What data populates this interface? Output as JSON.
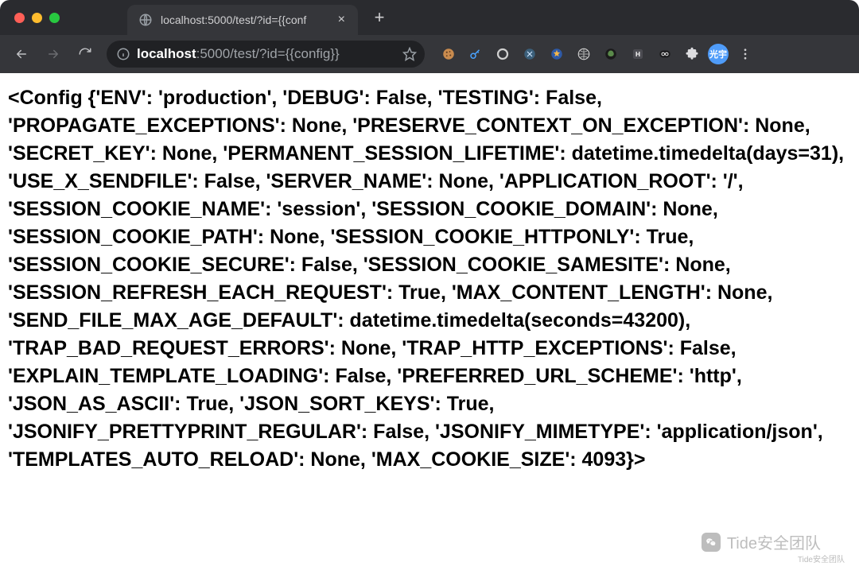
{
  "browser": {
    "tab_title": "localhost:5000/test/?id={{conf",
    "new_tab_label": "+",
    "close_tab_label": "×",
    "url_host": "localhost",
    "url_port_path": ":5000/test/?id={{config}}",
    "avatar_label": "光宇"
  },
  "icons": {
    "back": "back-icon",
    "forward": "forward-icon",
    "reload": "reload-icon",
    "info": "info-icon",
    "star": "star-outline-icon",
    "extensions": "puzzle-icon",
    "menu": "kebab-icon"
  },
  "page": {
    "body_text": "<Config {'ENV': 'production', 'DEBUG': False, 'TESTING': False, 'PROPAGATE_EXCEPTIONS': None, 'PRESERVE_CONTEXT_ON_EXCEPTION': None, 'SECRET_KEY': None, 'PERMANENT_SESSION_LIFETIME': datetime.timedelta(days=31), 'USE_X_SENDFILE': False, 'SERVER_NAME': None, 'APPLICATION_ROOT': '/', 'SESSION_COOKIE_NAME': 'session', 'SESSION_COOKIE_DOMAIN': None, 'SESSION_COOKIE_PATH': None, 'SESSION_COOKIE_HTTPONLY': True, 'SESSION_COOKIE_SECURE': False, 'SESSION_COOKIE_SAMESITE': None, 'SESSION_REFRESH_EACH_REQUEST': True, 'MAX_CONTENT_LENGTH': None, 'SEND_FILE_MAX_AGE_DEFAULT': datetime.timedelta(seconds=43200), 'TRAP_BAD_REQUEST_ERRORS': None, 'TRAP_HTTP_EXCEPTIONS': False, 'EXPLAIN_TEMPLATE_LOADING': False, 'PREFERRED_URL_SCHEME': 'http', 'JSON_AS_ASCII': True, 'JSON_SORT_KEYS': True, 'JSONIFY_PRETTYPRINT_REGULAR': False, 'JSONIFY_MIMETYPE': 'application/json', 'TEMPLATES_AUTO_RELOAD': None, 'MAX_COOKIE_SIZE': 4093}>"
  },
  "watermark": {
    "text": "Tide安全团队",
    "sub": "Tide安全团队"
  }
}
